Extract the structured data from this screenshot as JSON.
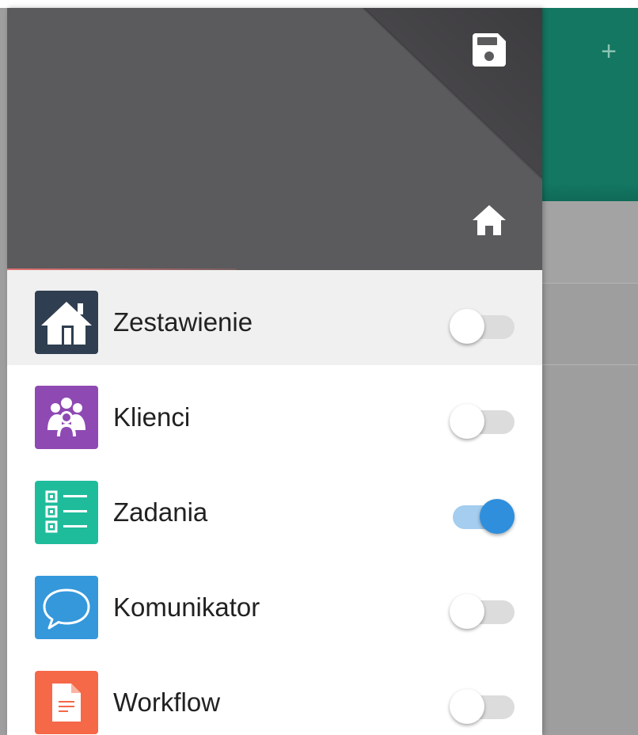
{
  "background_app": {
    "add_icon": "plus-icon",
    "add_glyph": "+",
    "appbar_color": "#137762"
  },
  "drawer": {
    "header": {
      "color": "#5b5a5d",
      "save_icon": "floppy-disk-icon",
      "home_icon": "home-icon"
    },
    "items": [
      {
        "label": "Zestawienie",
        "icon": "house-icon",
        "icon_bg": "#2f3e50",
        "active": true,
        "toggle_on": false
      },
      {
        "label": "Klienci",
        "icon": "people-group-icon",
        "icon_bg": "#8e49b2",
        "active": false,
        "toggle_on": false
      },
      {
        "label": "Zadania",
        "icon": "checklist-icon",
        "icon_bg": "#1fbc9c",
        "active": false,
        "toggle_on": true
      },
      {
        "label": "Komunikator",
        "icon": "speech-bubble-icon",
        "icon_bg": "#3498db",
        "active": false,
        "toggle_on": false
      },
      {
        "label": "Workflow",
        "icon": "document-icon",
        "icon_bg": "#f56848",
        "active": false,
        "toggle_on": false
      }
    ]
  },
  "colors": {
    "toggle_on_thumb": "#2f8fdc",
    "toggle_on_track": "#a4cdef",
    "toggle_off_track": "#dcdcdc",
    "active_row": "#f0f0f0"
  }
}
